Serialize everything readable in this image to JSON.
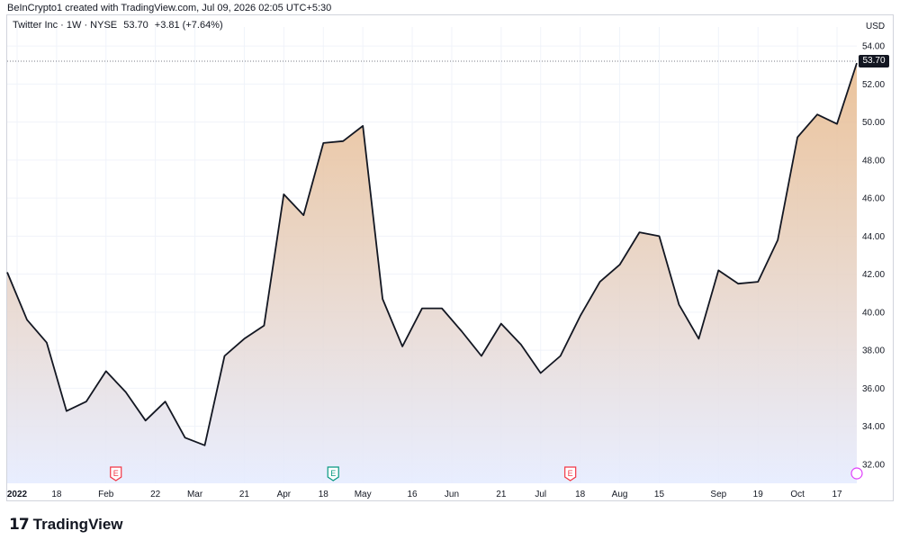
{
  "credit": "BeInCrypto1 created with TradingView.com, Jul 09, 2026 02:05 UTC+5:30",
  "legend": {
    "symbol": "Twitter Inc · 1W · NYSE",
    "last": "53.70",
    "change": "+3.81 (+7.64%)"
  },
  "currency": "USD",
  "last_price_badge": "53.70",
  "brand": {
    "name": "TradingView",
    "mark": "17"
  },
  "colors": {
    "line": "#131722",
    "area_top": "#e8b98a",
    "area_bottom": "#e6ecff",
    "grid": "#f0f3fa",
    "earnings_red": "#f23645",
    "earnings_green": "#089981",
    "purple_marker": "#e040fb"
  },
  "chart_data": {
    "type": "area",
    "title": "Twitter Inc · 1W · NYSE",
    "ylabel": "USD",
    "ylim": [
      31.0,
      55.0
    ],
    "y_ticks": [
      "32.00",
      "34.00",
      "36.00",
      "38.00",
      "40.00",
      "42.00",
      "44.00",
      "46.00",
      "48.00",
      "50.00",
      "52.00",
      "54.00"
    ],
    "x_tick_labels": [
      {
        "label": "2022",
        "week": 0.5,
        "bold": true
      },
      {
        "label": "18",
        "week": 2.5
      },
      {
        "label": "Feb",
        "week": 5.0
      },
      {
        "label": "22",
        "week": 7.5
      },
      {
        "label": "Mar",
        "week": 9.5
      },
      {
        "label": "21",
        "week": 12.0
      },
      {
        "label": "Apr",
        "week": 14.0
      },
      {
        "label": "18",
        "week": 16.0
      },
      {
        "label": "May",
        "week": 18.0
      },
      {
        "label": "16",
        "week": 20.5
      },
      {
        "label": "Jun",
        "week": 22.5
      },
      {
        "label": "21",
        "week": 25.0
      },
      {
        "label": "Jul",
        "week": 27.0
      },
      {
        "label": "18",
        "week": 29.0
      },
      {
        "label": "Aug",
        "week": 31.0
      },
      {
        "label": "15",
        "week": 33.0
      },
      {
        "label": "Sep",
        "week": 36.0
      },
      {
        "label": "19",
        "week": 38.0
      },
      {
        "label": "Oct",
        "week": 40.0
      },
      {
        "label": "17",
        "week": 42.0
      }
    ],
    "series": [
      {
        "values": [
          42.1,
          39.6,
          38.4,
          34.8,
          35.3,
          36.9,
          35.8,
          34.3,
          35.3,
          33.4,
          33.0,
          37.7,
          38.6,
          39.3,
          46.2,
          45.1,
          48.9,
          49.0,
          49.8,
          40.7,
          38.2,
          40.2,
          40.2,
          39.0,
          37.7,
          39.4,
          38.3,
          36.8,
          37.7,
          39.8,
          41.6,
          42.5,
          44.2,
          44.0,
          40.4,
          38.6,
          42.2,
          41.5,
          41.6,
          43.8,
          49.2,
          50.4,
          49.9,
          53.1
        ]
      }
    ],
    "earnings_markers": [
      {
        "label": "E",
        "week": 5.5,
        "kind": "red"
      },
      {
        "label": "E",
        "week": 16.5,
        "kind": "green"
      },
      {
        "label": "E",
        "week": 28.5,
        "kind": "red"
      }
    ]
  }
}
